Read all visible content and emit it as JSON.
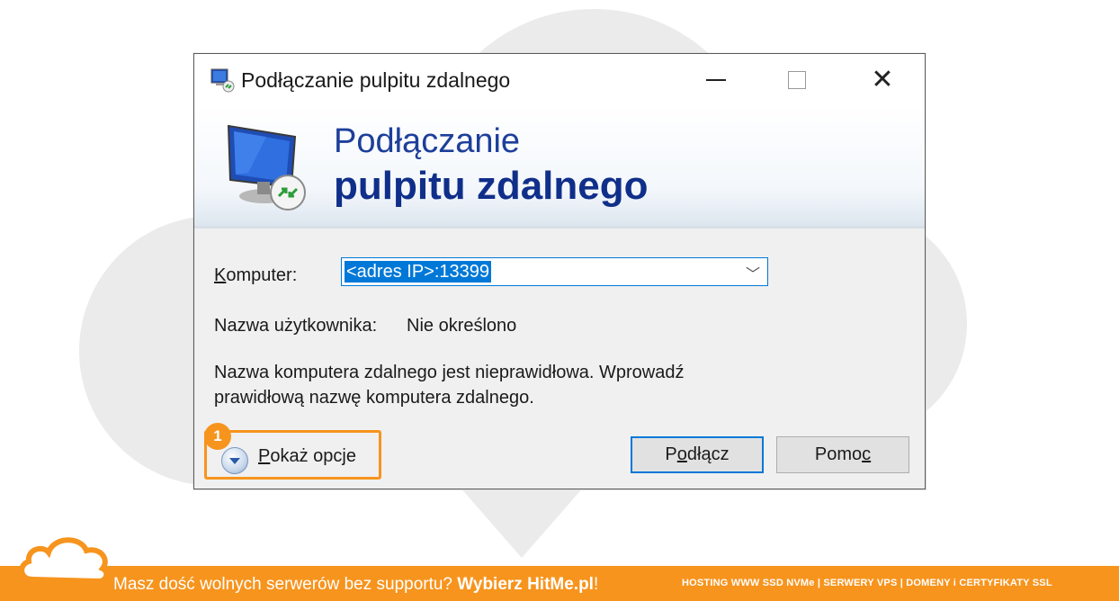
{
  "window": {
    "title": "Podłączanie pulpitu zdalnego",
    "controls": {
      "minimize_icon": "minimize-icon",
      "maximize_icon": "maximize-icon",
      "close_icon": "close-icon"
    }
  },
  "banner": {
    "title_line1": "Podłączanie",
    "title_line2": "pulpitu zdalnego",
    "icon": "remote-desktop-icon"
  },
  "form": {
    "computer_label_first": "K",
    "computer_label_rest": "omputer:",
    "computer_value": "<adres IP>:13399",
    "username_label": "Nazwa użytkownika:",
    "username_value": "Nie określono",
    "error_message_line1": "Nazwa komputera zdalnego jest nieprawidłowa. Wprowadź",
    "error_message_line2": "prawidłową nazwę komputera zdalnego."
  },
  "buttons": {
    "show_options_first": "P",
    "show_options_rest": "okaż opcje",
    "connect_pre": "P",
    "connect_u": "o",
    "connect_post": "dłącz",
    "help_pre": "Pomo",
    "help_u": "c"
  },
  "annotation": {
    "badge_number": "1",
    "highlight_color": "#f7941d"
  },
  "footer": {
    "text_regular": "Masz dość wolnych serwerów bez supportu? ",
    "text_bold": "Wybierz HitMe.pl",
    "text_end": "!",
    "right_text": "HOSTING WWW SSD NVMe | SERWERY VPS | DOMENY i CERTYFIKATY SSL",
    "accent_color": "#f7941d"
  }
}
